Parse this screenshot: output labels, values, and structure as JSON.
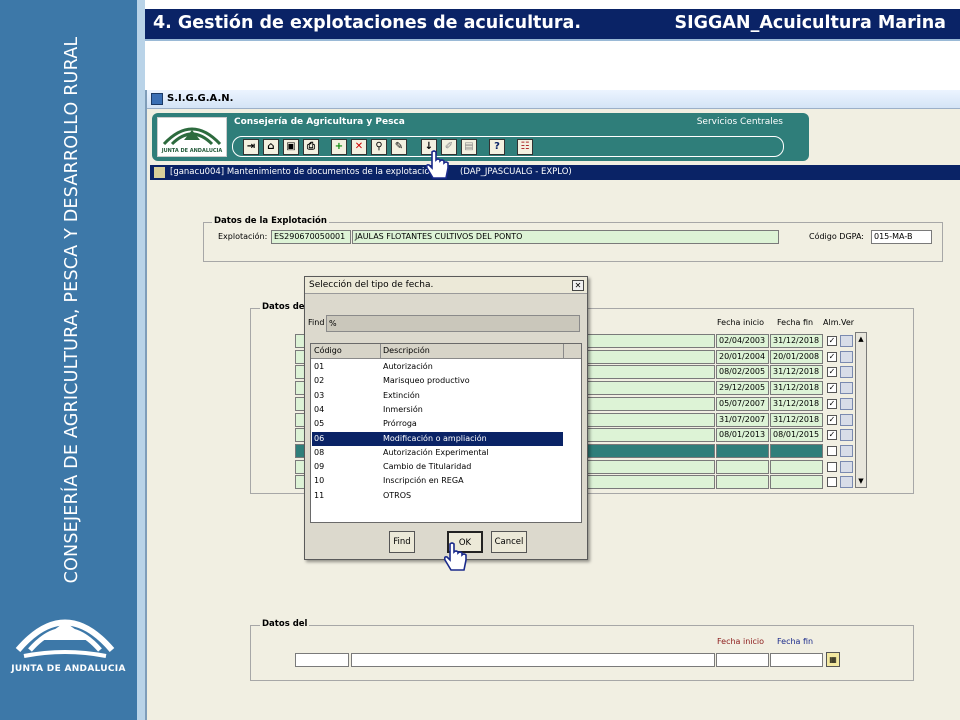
{
  "slide": {
    "title": "4. Gestión de explotaciones de acuicultura.",
    "subtitle": "SIGGAN_Acuicultura Marina",
    "side_text": "CONSEJERÍA DE AGRICULTURA, PESCA Y DESARROLLO RURAL",
    "logo_text": "JUNTA DE ANDALUCIA"
  },
  "app": {
    "window_title": "S.I.G.G.A.N.",
    "header_org": "Consejería de Agricultura y Pesca",
    "header_service": "Servicios Centrales",
    "header_logo_text": "JUNTA DE ANDALUCIA",
    "subwindow_title": "[ganacu004] Mantenimiento de documentos de la explotación",
    "subwindow_user": "(DAP_JPASCUALG - EXPLO)"
  },
  "explotacion": {
    "frame_title": "Datos de la Explotación",
    "label": "Explotación:",
    "code": "ES290670050001",
    "name": "JAULAS FLOTANTES CULTIVOS DEL PONTO",
    "dgpa_label": "Código DGPA:",
    "dgpa": "015-MA-B"
  },
  "documentos": {
    "frame_title": "Datos de",
    "col_inicio": "Fecha inicio",
    "col_fin": "Fecha fin",
    "col_alm": "Alm.Ver",
    "rows": [
      {
        "inicio": "02/04/2003",
        "fin": "31/12/2018"
      },
      {
        "inicio": "20/01/2004",
        "fin": "20/01/2008"
      },
      {
        "inicio": "08/02/2005",
        "fin": "31/12/2018"
      },
      {
        "inicio": "29/12/2005",
        "fin": "31/12/2018"
      },
      {
        "inicio": "05/07/2007",
        "fin": "31/12/2018"
      },
      {
        "inicio": "31/07/2007",
        "fin": "31/12/2018"
      },
      {
        "inicio": "08/01/2013",
        "fin": "08/01/2015"
      }
    ]
  },
  "detalle": {
    "frame_title": "Datos del",
    "col_inicio": "Fecha inicio",
    "col_fin": "Fecha fin"
  },
  "dialog": {
    "title": "Selección del tipo de fecha.",
    "find_label": "Find",
    "find_value": "%",
    "col_codigo": "Código",
    "col_descripcion": "Descripción",
    "items": [
      {
        "code": "01",
        "desc": "Autorización"
      },
      {
        "code": "02",
        "desc": "Marisqueo productivo"
      },
      {
        "code": "03",
        "desc": "Extinción"
      },
      {
        "code": "04",
        "desc": "Inmersión"
      },
      {
        "code": "05",
        "desc": "Prórroga"
      },
      {
        "code": "06",
        "desc": "Modificación o ampliación"
      },
      {
        "code": "08",
        "desc": "Autorización Experimental"
      },
      {
        "code": "09",
        "desc": "Cambio de Titularidad"
      },
      {
        "code": "10",
        "desc": "Inscripción en REGA"
      },
      {
        "code": "11",
        "desc": "OTROS"
      }
    ],
    "selected_index": 5,
    "btn_find": "Find",
    "btn_ok": "OK",
    "btn_cancel": "Cancel"
  },
  "colors": {
    "title_bar": "#0a2366",
    "side_band": "#3d78a8",
    "header_teal": "#2f7e7a",
    "field_green": "#ddf3d6",
    "selection": "#0a2366"
  }
}
